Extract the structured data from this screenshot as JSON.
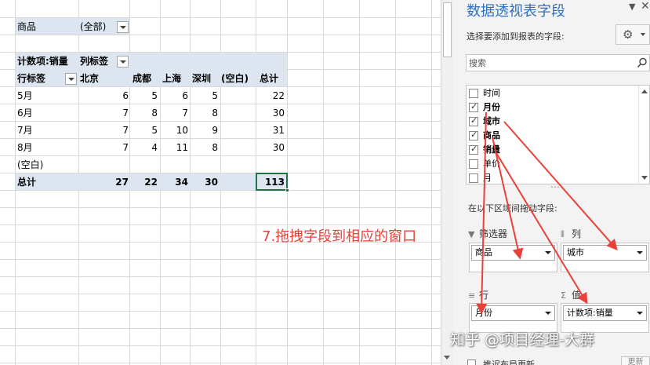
{
  "sheet": {
    "filter_field": "商品",
    "filter_value": "(全部)",
    "value_header": "计数项:销量",
    "col_label_header": "列标签",
    "row_label_header": "行标签",
    "columns": [
      "北京",
      "成都",
      "上海",
      "深圳",
      "(空白)",
      "总计"
    ],
    "rows": [
      {
        "label": "5月",
        "values": [
          "6",
          "5",
          "6",
          "5",
          "",
          "22"
        ]
      },
      {
        "label": "6月",
        "values": [
          "7",
          "8",
          "7",
          "8",
          "",
          "30"
        ]
      },
      {
        "label": "7月",
        "values": [
          "7",
          "5",
          "10",
          "9",
          "",
          "31"
        ]
      },
      {
        "label": "8月",
        "values": [
          "7",
          "4",
          "11",
          "8",
          "",
          "30"
        ]
      },
      {
        "label": "(空白)",
        "values": [
          "",
          "",
          "",
          "",
          "",
          ""
        ]
      }
    ],
    "total_row": {
      "label": "总计",
      "values": [
        "27",
        "22",
        "34",
        "30",
        "",
        "113"
      ]
    },
    "annotation": "7.拖拽字段到相应的窗口"
  },
  "pane": {
    "title": "数据透视表字段",
    "choose_label": "选择要添加到报表的字段:",
    "search_placeholder": "搜索",
    "fields": [
      {
        "name": "时间",
        "checked": false
      },
      {
        "name": "月份",
        "checked": true
      },
      {
        "name": "城市",
        "checked": true
      },
      {
        "name": "商品",
        "checked": true
      },
      {
        "name": "销量",
        "checked": true
      },
      {
        "name": "单价",
        "checked": false
      },
      {
        "name": "月",
        "checked": false
      }
    ],
    "areas_label": "在以下区域间拖动字段:",
    "areas": {
      "filters": {
        "title": "筛选器",
        "item": "商品"
      },
      "columns": {
        "title": "列",
        "item": "城市"
      },
      "rows": {
        "title": "行",
        "item": "月份"
      },
      "values": {
        "title": "值",
        "item": "计数项:销量"
      }
    },
    "defer_label": "推迟布局更新",
    "update_label": "更新"
  },
  "watermark": "知乎 @项目经理-大群",
  "colors": {
    "accent": "#2f6fbd",
    "arrow": "#e8413a",
    "header_bg": "#dde6f0",
    "selection": "#217346"
  }
}
